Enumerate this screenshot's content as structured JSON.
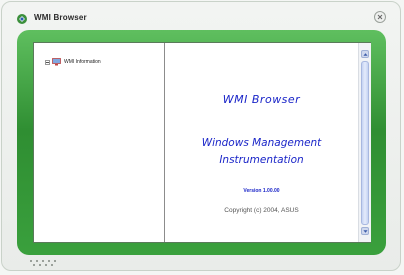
{
  "window": {
    "title": "WMI Browser"
  },
  "tree": {
    "items": [
      {
        "label": "WMI Information"
      }
    ]
  },
  "content": {
    "title": "WMI Browser",
    "subtitle_line1": "Windows Management",
    "subtitle_line2": "Instrumentation",
    "version": "Version 1.00.00",
    "copyright": "Copyright (c) 2004, ASUS"
  },
  "colors": {
    "frame_green": "#3aa03d",
    "text_blue": "#1a25c8"
  },
  "icons": {
    "app": "app-icon",
    "close": "close-icon",
    "tree_node": "computer-icon"
  }
}
